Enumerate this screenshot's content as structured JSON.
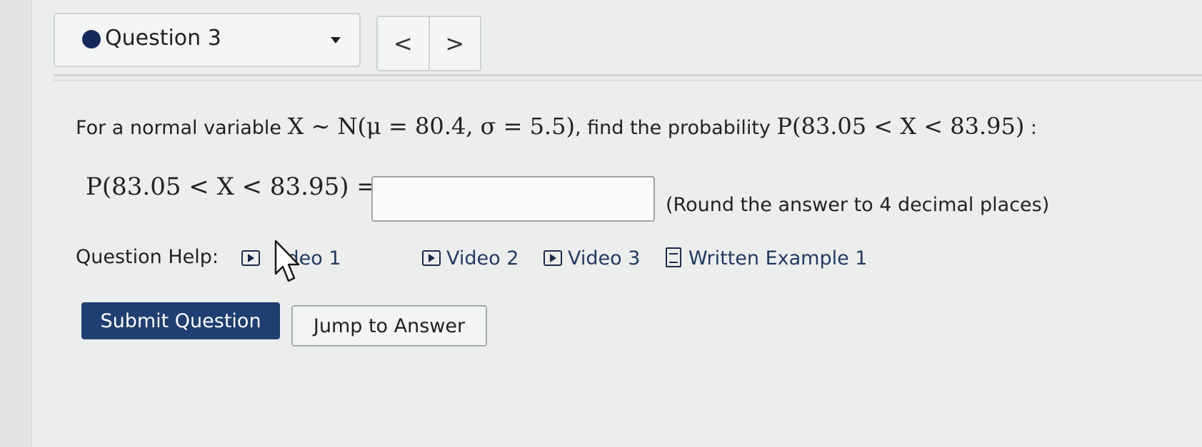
{
  "header": {
    "question_title": "Question 3",
    "prev_label": "<",
    "next_label": ">"
  },
  "question": {
    "intro": "For a normal variable ",
    "distribution": "X ∼ N(μ = 80.4, σ = 5.5)",
    "mid": ", find the probability ",
    "probability": "P(83.05 < X < 83.95)",
    "end": " :"
  },
  "answer": {
    "lhs": "P(83.05 < X < 83.95) =",
    "value": "",
    "placeholder": "",
    "note": "(Round the answer to 4 decimal places)"
  },
  "help": {
    "label": "Question Help:",
    "items": [
      {
        "label": "Video 1",
        "visible_text": "ideo 1",
        "icon": "video-icon"
      },
      {
        "label": "Video 2",
        "visible_text": "Video 2",
        "icon": "video-icon"
      },
      {
        "label": "Video 3",
        "visible_text": "Video 3",
        "icon": "video-icon"
      },
      {
        "label": "Written Example 1",
        "visible_text": "Written Example 1",
        "icon": "document-icon"
      }
    ]
  },
  "buttons": {
    "submit": "Submit Question",
    "jump": "Jump to Answer"
  },
  "colors": {
    "primary_button": "#1f3f72",
    "status_dot": "#15295a",
    "link": "#223a60"
  }
}
